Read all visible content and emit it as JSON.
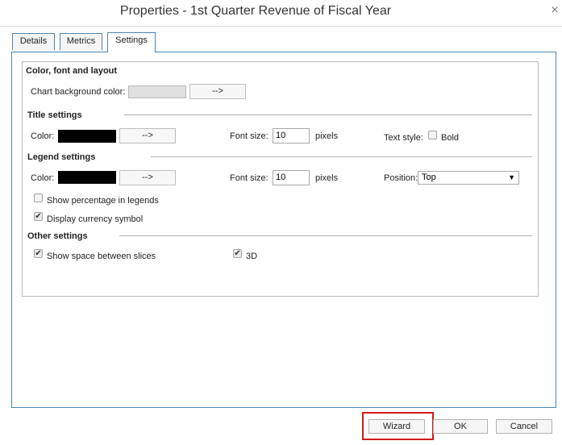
{
  "window": {
    "title": "Properties - 1st Quarter Revenue of Fiscal Year",
    "close_glyph": "×"
  },
  "tabs": [
    {
      "label": "Details",
      "active": false
    },
    {
      "label": "Metrics",
      "active": false
    },
    {
      "label": "Settings",
      "active": true
    }
  ],
  "settings": {
    "color_font_layout": {
      "heading": "Color, font and layout",
      "bg_label": "Chart background color:",
      "bg_color": "#e0e0e0",
      "arrow_label": "-->"
    },
    "title_settings": {
      "heading": "Title settings",
      "color_label": "Color:",
      "color_value": "#000000",
      "arrow_label": "-->",
      "font_size_label": "Font size:",
      "font_size_value": "10",
      "pixels_label": "pixels",
      "text_style_label": "Text style:",
      "bold_label": "Bold",
      "bold_checked": false
    },
    "legend_settings": {
      "heading": "Legend settings",
      "color_label": "Color:",
      "color_value": "#000000",
      "arrow_label": "-->",
      "font_size_label": "Font size:",
      "font_size_value": "10",
      "pixels_label": "pixels",
      "position_label": "Position:",
      "position_value": "Top",
      "show_percentage_label": "Show percentage in legends",
      "show_percentage_checked": false,
      "currency_label": "Display currency symbol",
      "currency_checked": true
    },
    "other_settings": {
      "heading": "Other settings",
      "space_label": "Show space between slices",
      "space_checked": true,
      "three_d_label": "3D",
      "three_d_checked": true
    }
  },
  "footer": {
    "wizard_label": "Wizard",
    "ok_label": "OK",
    "cancel_label": "Cancel"
  },
  "accent_colors": {
    "tab_border": "#4a86b6",
    "highlight": "#d11a1a"
  }
}
